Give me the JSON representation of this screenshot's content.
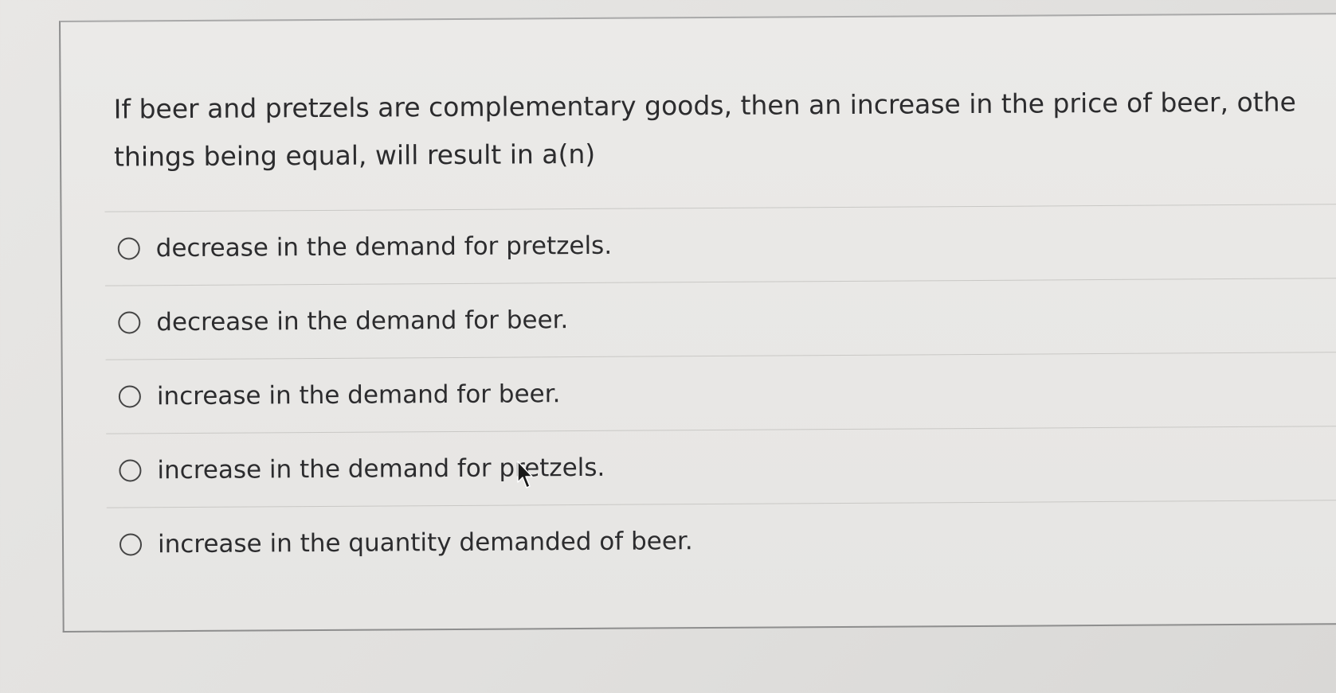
{
  "question": {
    "line1": "If beer and pretzels are complementary goods, then an increase in the price of beer, othe",
    "line2": "things being equal, will result in a(n)"
  },
  "options": [
    {
      "label": "decrease in the demand for pretzels.",
      "selected": false
    },
    {
      "label": "decrease in the demand for beer.",
      "selected": false
    },
    {
      "label": "increase in the demand for beer.",
      "selected": false
    },
    {
      "label": "increase in the demand for pretzels.",
      "selected": false
    },
    {
      "label": "increase in the quantity demanded of beer.",
      "selected": false
    }
  ],
  "icons": {
    "radio": "radio-button-icon",
    "cursor": "mouse-pointer-icon"
  }
}
